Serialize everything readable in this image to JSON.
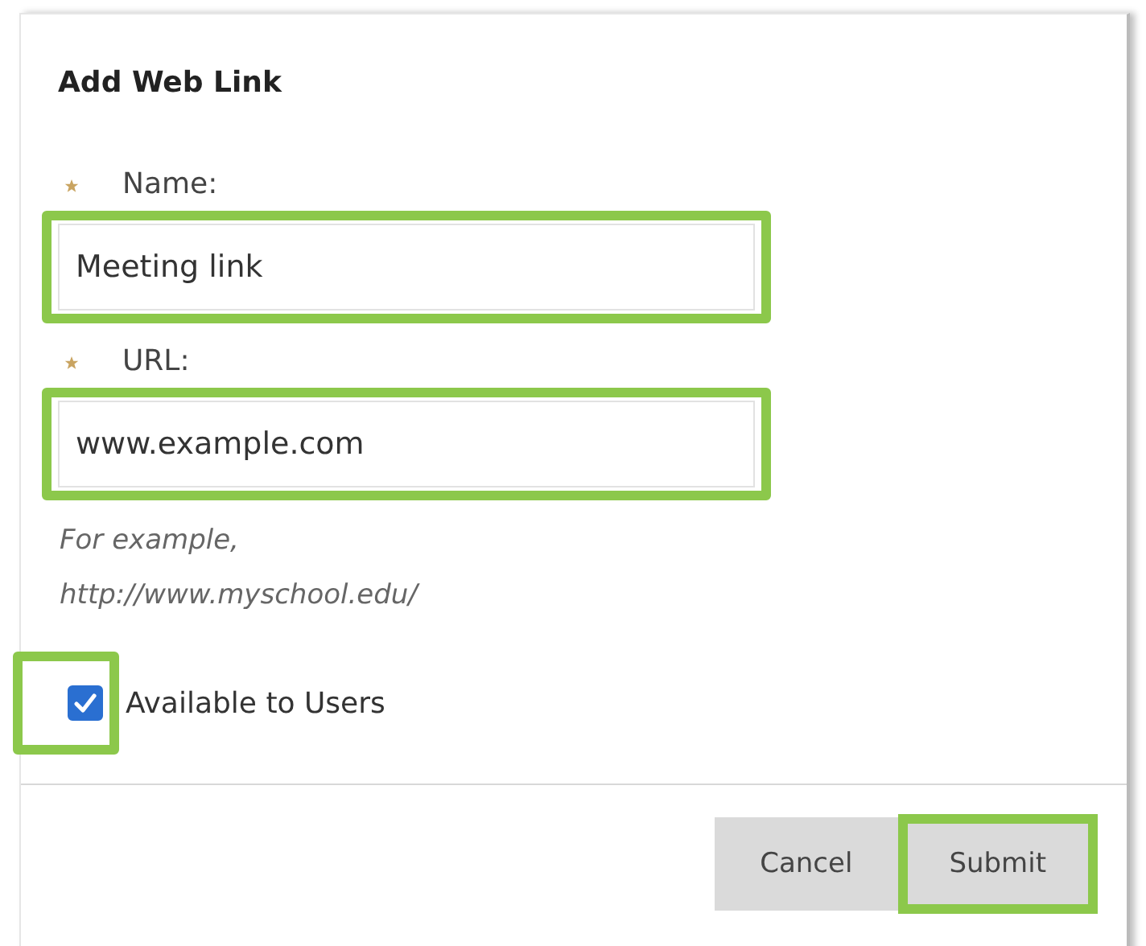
{
  "dialog": {
    "title": "Add Web Link"
  },
  "fields": [
    {
      "label": "Name:",
      "required": true,
      "value": "Meeting link",
      "highlighted": true
    },
    {
      "label": "URL:",
      "required": true,
      "value": "www.example.com",
      "highlighted": true,
      "hint": [
        "For example,",
        "http://www.myschool.edu/"
      ]
    }
  ],
  "checkbox": {
    "label": "Available to Users",
    "checked": true,
    "highlighted": true
  },
  "buttons": [
    {
      "label": "Cancel",
      "highlighted": false
    },
    {
      "label": "Submit",
      "highlighted": true
    }
  ]
}
